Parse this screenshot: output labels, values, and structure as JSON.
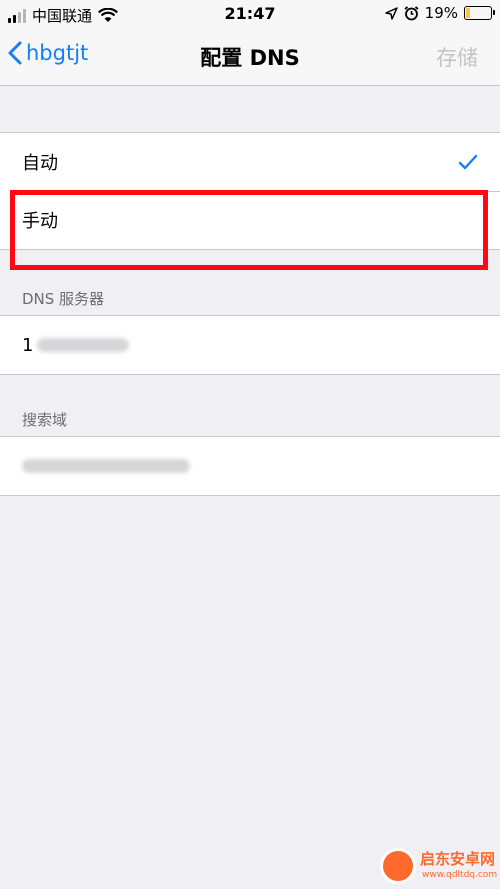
{
  "status_bar": {
    "carrier": "中国联通",
    "time": "21:47",
    "battery": "19%",
    "battery_level": 0.19
  },
  "nav": {
    "back_label": "hbgtjt",
    "title": "配置 DNS",
    "save_label": "存储"
  },
  "mode_options": [
    {
      "label": "自动",
      "selected": true
    },
    {
      "label": "手动",
      "selected": false
    }
  ],
  "dns_section": {
    "title": "DNS 服务器",
    "server_value": "1"
  },
  "search_section": {
    "title": "搜索域"
  },
  "watermark": {
    "name": "启东安卓网",
    "url": "www.qdltdq.com"
  },
  "colors": {
    "accent": "#157efb",
    "highlight": "#ff0a14",
    "disabled": "#c4c4c7"
  }
}
